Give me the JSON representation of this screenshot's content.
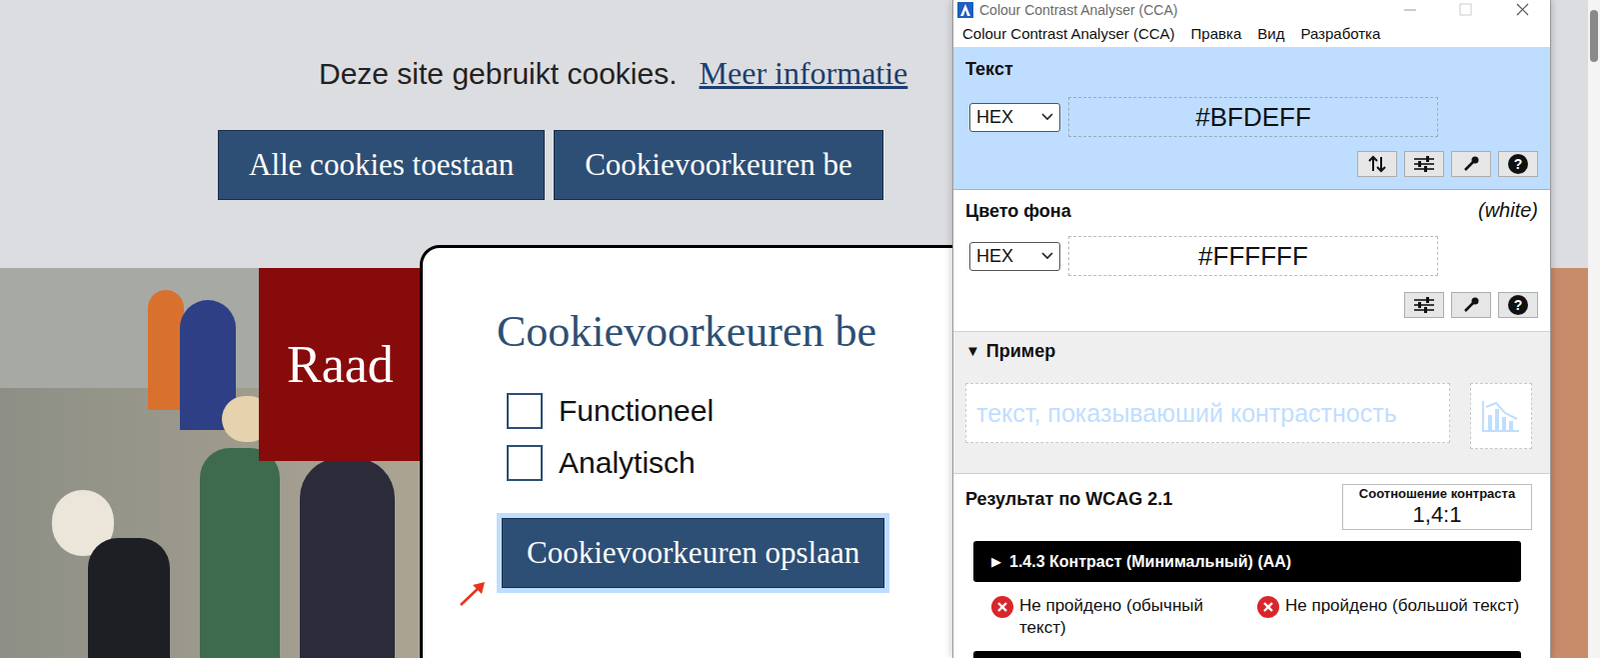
{
  "page": {
    "banner": {
      "text": "Deze site gebruikt cookies.",
      "link": "Meer informatie",
      "buttons": [
        "Alle cookies toestaan",
        "Cookievoorkeuren be"
      ]
    },
    "logo": "Raad",
    "modal": {
      "title": "Cookievoorkeuren be",
      "options": [
        {
          "label": "Functioneel",
          "checked": false
        },
        {
          "label": "Analytisch",
          "checked": false
        }
      ],
      "save_button": {
        "label": "Cookievoorkeuren opslaan",
        "focused": true
      }
    }
  },
  "cca": {
    "window": {
      "title": "Colour Contrast Analyser (CCA)"
    },
    "menu": [
      "Colour Contrast Analyser (CCA)",
      "Правка",
      "Вид",
      "Разработка"
    ],
    "foreground": {
      "heading": "Текст",
      "format": "HEX",
      "value": "#BFDEFF",
      "help": "?"
    },
    "background": {
      "heading": "Цвето фона",
      "name": "(white)",
      "format": "HEX",
      "value": "#FFFFFF",
      "help": "?"
    },
    "preview": {
      "toggle": "▼",
      "heading": "Пример",
      "sample": "текст, показываюший контрастность"
    },
    "results": {
      "heading": "Результат по WCAG 2.1",
      "ratio_label": "Соотношение контраста",
      "ratio": "1,4:1",
      "criteria": [
        {
          "toggle": "▶",
          "title": "1.4.3 Контраст (Минимальный) (AA)",
          "checks": [
            {
              "label": "Не пройдено (обычный текст)",
              "passed": false
            },
            {
              "label": "Не пройдено (большой текст)",
              "passed": false
            }
          ]
        }
      ]
    }
  }
}
